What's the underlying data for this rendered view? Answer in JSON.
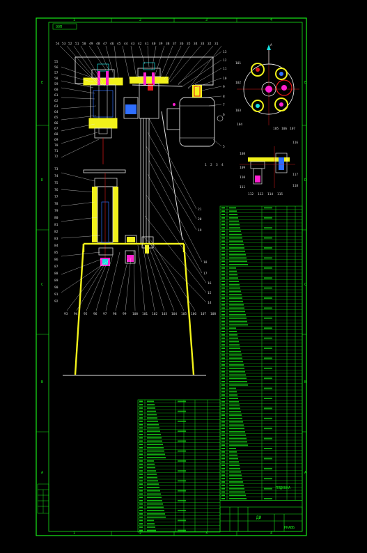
{
  "drawing": {
    "stamp_label": "ООП",
    "border_color": "#17e817",
    "frame_color": "#e0e0e0",
    "accent_colors": {
      "frame_yellow": "#f2f21a",
      "section_red": "#e01919",
      "section_blue": "#2f6fff",
      "section_magenta": "#ff1fd0",
      "section_cyan": "#19e0e0",
      "leader_white": "#e8e8e8"
    },
    "zone_letters_left": [
      "E",
      "D",
      "C",
      "B",
      "A"
    ],
    "zone_numbers_top": [
      "1",
      "2",
      "3",
      "4"
    ],
    "zone_numbers_bottom": [
      "1",
      "2",
      "3",
      "4"
    ]
  },
  "callouts": {
    "top": [
      "54",
      "53",
      "52",
      "51",
      "50",
      "49",
      "48",
      "47",
      "46",
      "45",
      "44",
      "43",
      "42",
      "41",
      "40",
      "39",
      "38",
      "37",
      "36",
      "35",
      "34",
      "33",
      "32",
      "31"
    ],
    "right_upper": [
      "13",
      "12",
      "11",
      "10",
      "9",
      "8",
      "7",
      "6",
      "5"
    ],
    "left": [
      "55",
      "56",
      "57",
      "58",
      "59",
      "60",
      "61",
      "62",
      "63",
      "64",
      "65",
      "66",
      "67",
      "68",
      "69",
      "70",
      "71",
      "72",
      "73",
      "74",
      "75",
      "76",
      "77",
      "78",
      "79",
      "80",
      "81",
      "82",
      "83",
      "84",
      "85",
      "86",
      "87",
      "88",
      "89",
      "90",
      "91",
      "92"
    ],
    "bottom": [
      "93",
      "94",
      "95",
      "96",
      "97",
      "98",
      "99",
      "100",
      "101",
      "102",
      "103",
      "104",
      "105",
      "106",
      "107",
      "108"
    ],
    "motor_bottom": [
      "1",
      "2",
      "3",
      "4"
    ],
    "right_mid": [
      "21",
      "20",
      "19",
      "18",
      "17",
      "16",
      "15",
      "14"
    ],
    "gear_view": [
      "A",
      "101",
      "102",
      "103",
      "104",
      "105",
      "106",
      "107"
    ],
    "side_view": [
      "108",
      "109",
      "110",
      "111",
      "112",
      "113",
      "114",
      "115",
      "116",
      "117",
      "118"
    ]
  },
  "bom": {
    "title_block_label": "ДИ",
    "title_block_code": "РКАВБ",
    "stamp_right": "ПЛДОБКА"
  }
}
